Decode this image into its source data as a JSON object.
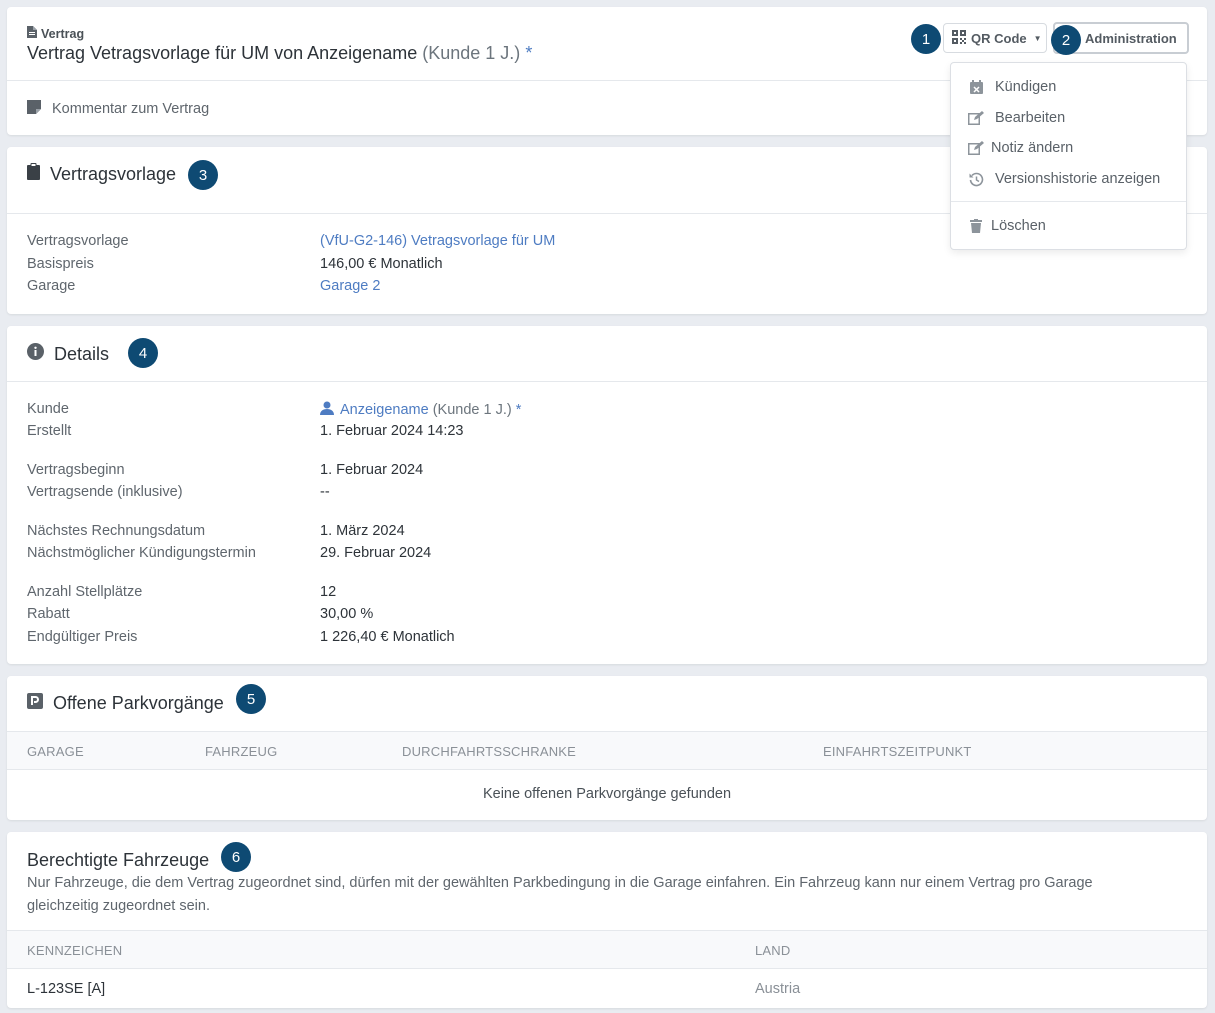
{
  "header": {
    "breadcrumb": "Vertrag",
    "title": "Vertrag Vetragsvorlage für UM von Anzeigename",
    "title_suffix": "(Kunde 1 J.)",
    "title_asterisk": "*",
    "comment": "Kommentar zum Vertrag",
    "qr_button": "QR Code",
    "admin_button": "Administration"
  },
  "badges": [
    "1",
    "2",
    "3",
    "4",
    "5",
    "6"
  ],
  "admin_menu": {
    "items": [
      "Kündigen",
      "Bearbeiten",
      "Notiz ändern",
      "Versionshistorie anzeigen"
    ],
    "delete": "Löschen"
  },
  "template_section": {
    "title": "Vertragsvorlage",
    "rows": [
      {
        "label": "Vertragsvorlage",
        "value": "(VfU-G2-146) Vetragsvorlage für UM"
      },
      {
        "label": "Basispreis",
        "value": "146,00 € Monatlich"
      },
      {
        "label": "Garage",
        "value": "Garage 2"
      }
    ]
  },
  "details_section": {
    "title": "Details",
    "customer_label": "Kunde",
    "customer_name": "Anzeigename",
    "customer_suffix": "(Kunde 1 J.)",
    "customer_asterisk": "*",
    "rows": [
      {
        "label": "Erstellt",
        "value": "1. Februar 2024 14:23"
      },
      {
        "label": "Vertragsbeginn",
        "value": "1. Februar 2024"
      },
      {
        "label": "Vertragsende (inklusive)",
        "value": "--"
      },
      {
        "label": "Nächstes Rechnungsdatum",
        "value": "1. März 2024"
      },
      {
        "label": "Nächstmöglicher Kündigungstermin",
        "value": "29. Februar 2024"
      },
      {
        "label": "Anzahl Stellplätze",
        "value": "12"
      },
      {
        "label": "Rabatt",
        "value": "30,00 %"
      },
      {
        "label": "Endgültiger Preis",
        "value": "1 226,40 € Monatlich"
      }
    ]
  },
  "parking_section": {
    "title": "Offene Parkvorgänge",
    "columns": [
      "GARAGE",
      "FAHRZEUG",
      "DURCHFAHRTSSCHRANKE",
      "EINFAHRTSZEITPUNKT"
    ],
    "empty": "Keine offenen Parkvorgänge gefunden"
  },
  "vehicles_section": {
    "title": "Berechtigte Fahrzeuge",
    "description": "Nur Fahrzeuge, die dem Vertrag zugeordnet sind, dürfen mit der gewählten Parkbedingung in die Garage einfahren. Ein Fahrzeug kann nur einem Vertrag pro Garage gleichzeitig zugeordnet sein.",
    "columns": [
      "KENNZEICHEN",
      "LAND"
    ],
    "rows": [
      {
        "plate": "L-123SE [A]",
        "country": "Austria"
      }
    ]
  },
  "colors": {
    "badge": "#0e4a73",
    "link": "#4e7cc2",
    "background": "#e9ecf1"
  }
}
